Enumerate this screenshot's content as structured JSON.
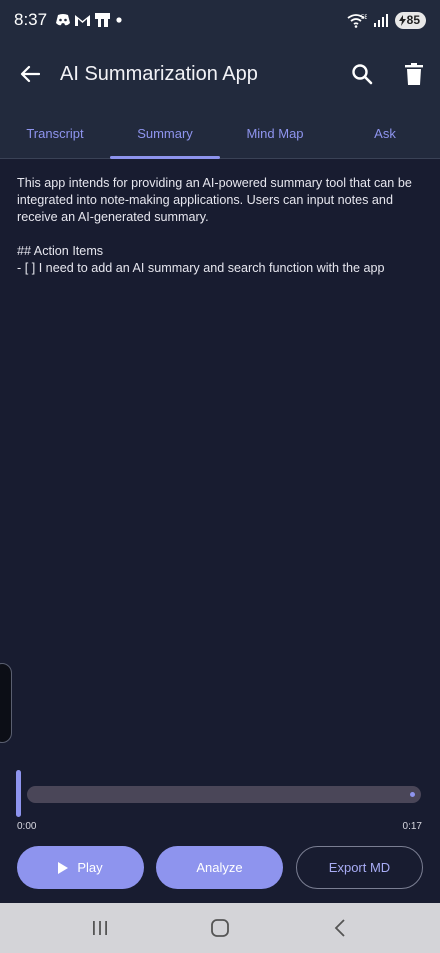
{
  "status_bar": {
    "time": "8:37",
    "battery": "85",
    "network_label": "5E"
  },
  "app_bar": {
    "title": "AI Summarization App"
  },
  "tabs": [
    {
      "label": "Transcript",
      "active": false
    },
    {
      "label": "Summary",
      "active": true
    },
    {
      "label": "Mind Map",
      "active": false
    },
    {
      "label": "Ask",
      "active": false
    }
  ],
  "summary": {
    "paragraph": "This app intends for providing an AI-powered summary tool that can be integrated into note-making applications. Users can input notes and receive an AI-generated summary.",
    "heading": "## Action Items",
    "item": "- [ ] I need to add an AI summary and search function with the app"
  },
  "player": {
    "current_time": "0:00",
    "duration": "0:17",
    "progress": 0
  },
  "actions": {
    "play_label": "Play",
    "analyze_label": "Analyze",
    "export_label": "Export MD"
  },
  "colors": {
    "accent": "#8e94ee",
    "background": "#181c30",
    "bar": "#222a3d"
  }
}
